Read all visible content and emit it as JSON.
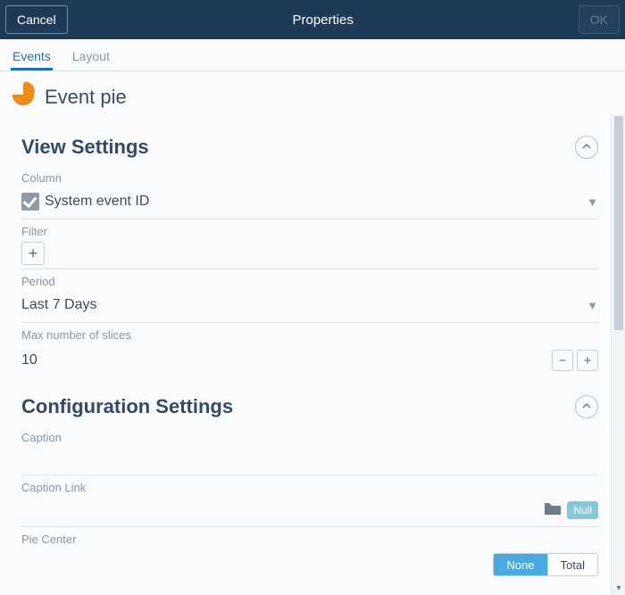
{
  "titlebar": {
    "cancel": "Cancel",
    "title": "Properties",
    "ok": "OK"
  },
  "tabs": {
    "events": "Events",
    "layout": "Layout"
  },
  "header": {
    "title": "Event pie"
  },
  "sections": {
    "view": {
      "title": "View Settings",
      "column_label": "Column",
      "column_value": "System event ID",
      "filter_label": "Filter",
      "period_label": "Period",
      "period_value": "Last 7 Days",
      "maxslices_label": "Max number of slices",
      "maxslices_value": "10"
    },
    "config": {
      "title": "Configuration Settings",
      "caption_label": "Caption",
      "caption_link_label": "Caption Link",
      "null_pill": "Null",
      "pie_center_label": "Pie Center",
      "seg_none": "None",
      "seg_total": "Total"
    }
  }
}
